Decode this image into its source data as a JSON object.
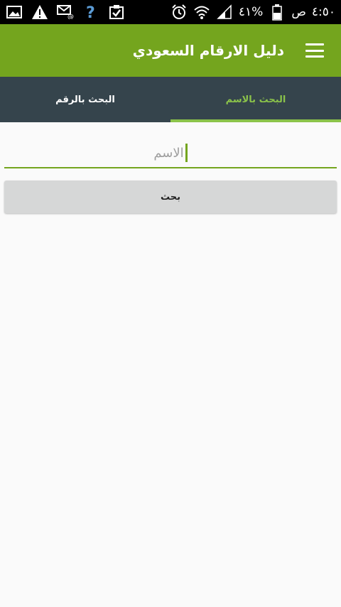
{
  "status_bar": {
    "time": "٤:٥٠",
    "am_pm": "ص",
    "battery": "٤١%",
    "left_icons": [
      "image-icon",
      "warning-icon",
      "mail-at-icon",
      "help-icon",
      "clipboard-check-icon"
    ],
    "right_icons": [
      "alarm-icon",
      "wifi-icon",
      "signal-icon",
      "battery-icon"
    ]
  },
  "app_bar": {
    "title": "دليل الارقام السعودي",
    "menu_icon": "hamburger-menu-icon",
    "color": "#74a51e"
  },
  "tabs": [
    {
      "label": "البحث بالرقم",
      "active": false
    },
    {
      "label": "البحث بالاسم",
      "active": true
    }
  ],
  "search_form": {
    "name_placeholder": "الاسم",
    "search_label": "بحث"
  },
  "colors": {
    "accent": "#8bc34a",
    "tab_bar": "#35444c",
    "background": "#fafafa"
  }
}
